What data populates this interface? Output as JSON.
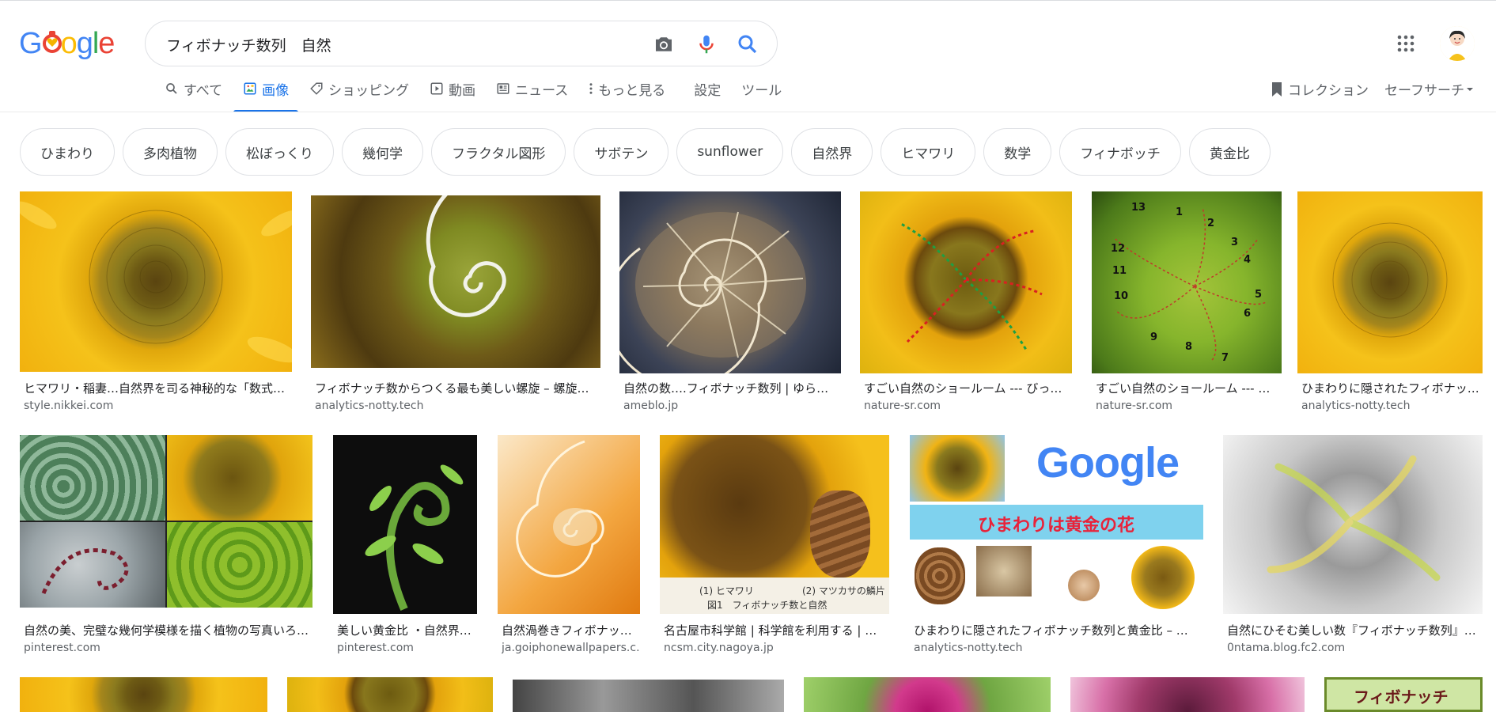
{
  "logo": {
    "letters": [
      "G",
      "o",
      "o",
      "g",
      "l",
      "e"
    ]
  },
  "search": {
    "query": "フィボナッチ数列　自然"
  },
  "tabs": {
    "all": "すべて",
    "images": "画像",
    "shopping": "ショッピング",
    "videos": "動画",
    "news": "ニュース",
    "more": "もっと見る",
    "settings": "設定",
    "tools": "ツール"
  },
  "right_tabs": {
    "collections": "コレクション",
    "safesearch": "セーフサーチ"
  },
  "chips": [
    "ひまわり",
    "多肉植物",
    "松ぼっくり",
    "幾何学",
    "フラクタル図形",
    "サボテン",
    "sunflower",
    "自然界",
    "ヒマワリ",
    "数学",
    "フィナボッチ",
    "黄金比"
  ],
  "results_row1": [
    {
      "caption": "ヒマワリ・稲妻…自然界を司る神秘的な「数式…",
      "source": "style.nikkei.com"
    },
    {
      "caption": "フィボナッチ数からつくる最も美しい螺旋 – 螺旋…",
      "source": "analytics-notty.tech"
    },
    {
      "caption": "自然の数….フィボナッチ数列 | ゆらの…",
      "source": "ameblo.jp"
    },
    {
      "caption": "すごい自然のショールーム --- びっ…",
      "source": "nature-sr.com"
    },
    {
      "caption": "すごい自然のショールーム --- …",
      "source": "nature-sr.com"
    },
    {
      "caption": "ひまわりに隠されたフィボナッ…",
      "source": "analytics-notty.tech"
    }
  ],
  "results_row2": [
    {
      "caption": "自然の美、完璧な幾何学模様を描く植物の写真いろ…",
      "source": "pinterest.com"
    },
    {
      "caption": "美しい黄金比 ・自然界…",
      "source": "pinterest.com"
    },
    {
      "caption": "自然渦巻きフィボナッ…",
      "source": "ja.goiphonewallpapers.c…"
    },
    {
      "caption": "名古屋市科学館 | 科学館を利用する | 展…",
      "source": "ncsm.city.nagoya.jp"
    },
    {
      "caption": "ひまわりに隠されたフィボナッチ数列と黄金比 – …",
      "source": "analytics-notty.tech"
    },
    {
      "caption": "自然にひそむ美しい数『フィボナッチ数列』…",
      "source": "0ntama.blog.fc2.com"
    }
  ],
  "image_text": {
    "google_logo": "Google",
    "himawari_banner": "ひまわりは黄金の花",
    "sunflower_label": "(1) ヒマワリ",
    "pinecone_label": "(2) マツカサの鱗片",
    "figure_caption": "図1　フィボナッチ数と自然",
    "fibonacci_sign": "フィボナッチ",
    "spiral_numbers": [
      "13",
      "1",
      "2",
      "3",
      "4",
      "5",
      "6",
      "7",
      "8",
      "9",
      "10",
      "11",
      "12"
    ]
  },
  "colors": {
    "accent": "#1a73e8",
    "chip_border": "#dfe1e5",
    "text_secondary": "#5f6368"
  }
}
